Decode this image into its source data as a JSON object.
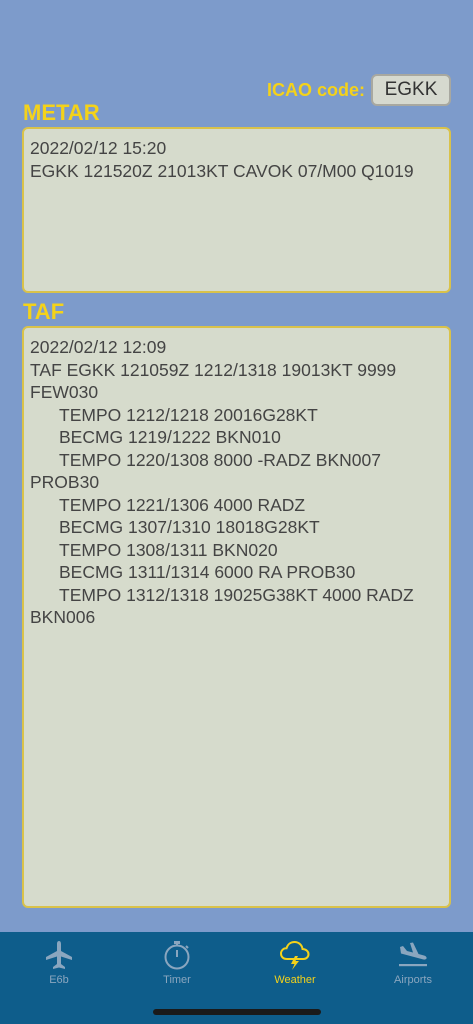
{
  "icao": {
    "label": "ICAO code:",
    "value": "EGKK"
  },
  "metar": {
    "title": "METAR",
    "lines": [
      {
        "text": "2022/02/12 15:20",
        "indent": false
      },
      {
        "text": "EGKK 121520Z 21013KT CAVOK 07/M00 Q1019",
        "indent": false
      }
    ]
  },
  "taf": {
    "title": "TAF",
    "lines": [
      {
        "text": "2022/02/12 12:09",
        "indent": false
      },
      {
        "text": "TAF EGKK 121059Z 1212/1318 19013KT 9999",
        "indent": false
      },
      {
        "text": "FEW030",
        "indent": false
      },
      {
        "text": "TEMPO 1212/1218 20016G28KT",
        "indent": true
      },
      {
        "text": "BECMG 1219/1222 BKN010",
        "indent": true
      },
      {
        "text": "TEMPO 1220/1308 8000 -RADZ BKN007",
        "indent": true
      },
      {
        "text": "PROB30",
        "indent": false
      },
      {
        "text": "TEMPO 1221/1306 4000 RADZ",
        "indent": true
      },
      {
        "text": "BECMG 1307/1310 18018G28KT",
        "indent": true
      },
      {
        "text": "TEMPO 1308/1311 BKN020",
        "indent": true
      },
      {
        "text": "BECMG 1311/1314 6000 RA PROB30",
        "indent": true
      },
      {
        "text": "TEMPO 1312/1318 19025G38KT 4000 RADZ",
        "indent": true
      },
      {
        "text": "BKN006",
        "indent": false
      }
    ]
  },
  "tabs": [
    {
      "label": "E6b",
      "icon": "airplane-icon",
      "active": false
    },
    {
      "label": "Timer",
      "icon": "stopwatch-icon",
      "active": false
    },
    {
      "label": "Weather",
      "icon": "cloud-lightning-icon",
      "active": true
    },
    {
      "label": "Airports",
      "icon": "airplane-landing-icon",
      "active": false
    }
  ],
  "colors": {
    "background": "#7d9bcb",
    "accent": "#f4d21a",
    "tabbar": "#0e5d8b",
    "tab_inactive": "#8aa6bf",
    "textbox": "#d6dbcc"
  }
}
